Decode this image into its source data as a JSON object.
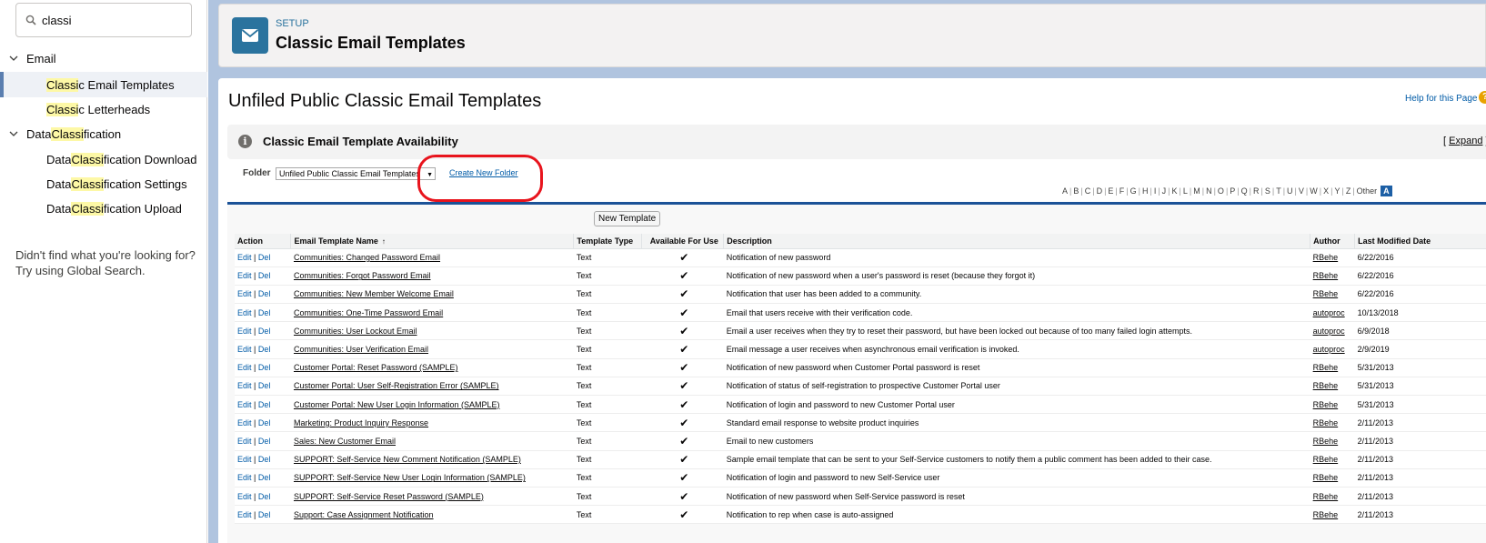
{
  "sidebar": {
    "search": {
      "value": "classi"
    },
    "groups": [
      {
        "label_parts": [
          "Email",
          ""
        ],
        "items": [
          {
            "hl": "Classi",
            "rest": "c Email Templates",
            "active": true
          },
          {
            "hl": "Classi",
            "rest": "c Letterheads",
            "active": false
          }
        ]
      },
      {
        "label_pre": "Data ",
        "label_hl": "Classi",
        "label_post": "fication",
        "items": [
          {
            "pre": "Data ",
            "hl": "Classi",
            "rest": "fication Download"
          },
          {
            "pre": "Data ",
            "hl": "Classi",
            "rest": "fication Settings"
          },
          {
            "pre": "Data ",
            "hl": "Classi",
            "rest": "fication Upload"
          }
        ]
      }
    ],
    "not_found_line1": "Didn't find what you're looking for?",
    "not_found_line2": "Try using Global Search."
  },
  "header": {
    "setup_label": "SETUP",
    "title": "Classic Email Templates"
  },
  "content": {
    "title": "Unfiled Public Classic Email Templates",
    "help_link": "Help for this Page",
    "availability_title": "Classic Email Template Availability",
    "expand_open": "[ ",
    "expand_link": "Expand",
    "expand_close": " ]",
    "folder_label": "Folder",
    "folder_value": "Unfiled Public Classic Email Templates",
    "new_folder_link": "Create New Folder",
    "alphabet": [
      "A",
      "B",
      "C",
      "D",
      "E",
      "F",
      "G",
      "H",
      "I",
      "J",
      "K",
      "L",
      "M",
      "N",
      "O",
      "P",
      "Q",
      "R",
      "S",
      "T",
      "U",
      "V",
      "W",
      "X",
      "Y",
      "Z",
      "Other"
    ],
    "alphabet_selected": "A",
    "new_template_button": "New Template",
    "columns": [
      "Action",
      "Email Template Name",
      "Template Type",
      "Available For Use",
      "Description",
      "Author",
      "Last Modified Date"
    ],
    "edit_label": "Edit",
    "del_label": "Del",
    "check_glyph": "✔",
    "rows": [
      {
        "name": "Communities: Changed Password Email",
        "type": "Text",
        "desc": "Notification of new password",
        "author": "RBehe",
        "date": "6/22/2016"
      },
      {
        "name": "Communities: Forgot Password Email",
        "type": "Text",
        "desc": "Notification of new password when a user's password is reset (because they forgot it)",
        "author": "RBehe",
        "date": "6/22/2016"
      },
      {
        "name": "Communities: New Member Welcome Email",
        "type": "Text",
        "desc": "Notification that user has been added to a community.",
        "author": "RBehe",
        "date": "6/22/2016"
      },
      {
        "name": "Communities: One-Time Password Email",
        "type": "Text",
        "desc": "Email that users receive with their verification code.",
        "author": "autoproc",
        "date": "10/13/2018"
      },
      {
        "name": "Communities: User Lockout Email",
        "type": "Text",
        "desc": "Email a user receives when they try to reset their password, but have been locked out because of too many failed login attempts.",
        "author": "autoproc",
        "date": "6/9/2018"
      },
      {
        "name": "Communities: User Verification Email",
        "type": "Text",
        "desc": "Email message a user receives when asynchronous email verification is invoked.",
        "author": "autoproc",
        "date": "2/9/2019"
      },
      {
        "name": "Customer Portal: Reset Password (SAMPLE)",
        "type": "Text",
        "desc": "Notification of new password when Customer Portal password is reset",
        "author": "RBehe",
        "date": "5/31/2013"
      },
      {
        "name": "Customer Portal: User Self-Registration Error (SAMPLE)",
        "type": "Text",
        "desc": "Notification of status of self-registration to prospective Customer Portal user",
        "author": "RBehe",
        "date": "5/31/2013"
      },
      {
        "name": "Customer Portal: New User Login Information (SAMPLE)",
        "type": "Text",
        "desc": "Notification of login and password to new Customer Portal user",
        "author": "RBehe",
        "date": "5/31/2013"
      },
      {
        "name": "Marketing: Product Inquiry Response",
        "type": "Text",
        "desc": "Standard email response to website product inquiries",
        "author": "RBehe",
        "date": "2/11/2013"
      },
      {
        "name": "Sales: New Customer Email",
        "type": "Text",
        "desc": "Email to new customers",
        "author": "RBehe",
        "date": "2/11/2013"
      },
      {
        "name": "SUPPORT: Self-Service New Comment Notification (SAMPLE)",
        "type": "Text",
        "desc": "Sample email template that can be sent to your Self-Service customers to notify them a public comment has been added to their case.",
        "author": "RBehe",
        "date": "2/11/2013"
      },
      {
        "name": "SUPPORT: Self-Service New User Login Information (SAMPLE)",
        "type": "Text",
        "desc": "Notification of login and password to new Self-Service user",
        "author": "RBehe",
        "date": "2/11/2013"
      },
      {
        "name": "SUPPORT: Self-Service Reset Password (SAMPLE)",
        "type": "Text",
        "desc": "Notification of new password when Self-Service password is reset",
        "author": "RBehe",
        "date": "2/11/2013"
      },
      {
        "name": "Support: Case Assignment Notification",
        "type": "Text",
        "desc": "Notification to rep when case is auto-assigned",
        "author": "RBehe",
        "date": "2/11/2013"
      }
    ]
  }
}
